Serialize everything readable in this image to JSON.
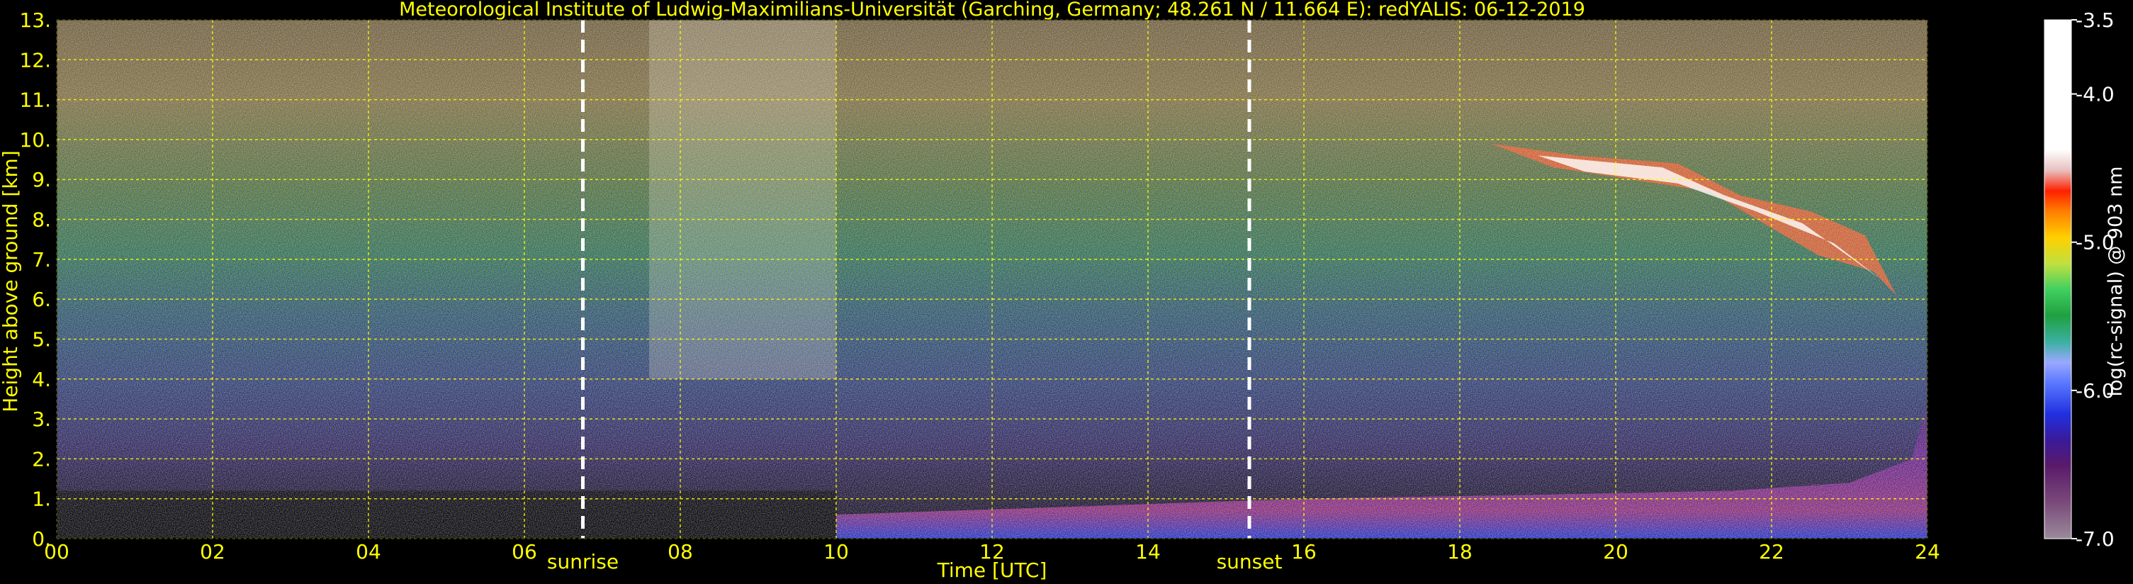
{
  "chart_data": {
    "type": "heatmap",
    "title": "Meteorological Institute of Ludwig-Maximilians-Universität (Garching, Germany; 48.261 N / 11.664 E):    redYALIS: 06-12-2019",
    "xlabel": "Time [UTC]",
    "ylabel": "Height above ground [km]",
    "xlim": [
      0,
      24
    ],
    "ylim": [
      0,
      13
    ],
    "x_ticks": [
      0,
      2,
      4,
      6,
      8,
      10,
      12,
      14,
      16,
      18,
      20,
      22,
      24
    ],
    "x_tick_labels": [
      "00",
      "02",
      "04",
      "06",
      "08",
      "10",
      "12",
      "14",
      "16",
      "18",
      "20",
      "22",
      "24"
    ],
    "y_ticks": [
      0,
      1,
      2,
      3,
      4,
      5,
      6,
      7,
      8,
      9,
      10,
      11,
      12,
      13
    ],
    "y_tick_labels": [
      "0.",
      "1.",
      "2.",
      "3.",
      "4.",
      "5.",
      "6.",
      "7.",
      "8.",
      "9.",
      "10.",
      "11.",
      "12.",
      "13."
    ],
    "grid": true,
    "events": [
      {
        "label": "sunrise",
        "time": 6.75
      },
      {
        "label": "sunset",
        "time": 15.3
      }
    ],
    "colorbar": {
      "label": "log(rc-signal) @ 903 nm",
      "range": [
        -7.0,
        -3.5
      ],
      "ticks": [
        -3.5,
        -4.0,
        -5.0,
        -6.0,
        -7.0
      ],
      "tick_labels": [
        "-3.5",
        "-4.0",
        "-5.0",
        "-6.0",
        "-7.0"
      ]
    },
    "features": [
      {
        "name": "cirrus-cloud",
        "time_start": 18.4,
        "time_end": 23.6,
        "height_top": 10.0,
        "height_bottom": 6.0
      },
      {
        "name": "boundary-layer",
        "time_start": 10.0,
        "time_end": 24.0,
        "height_top": 1.2,
        "height_bottom": 0.0
      }
    ]
  },
  "colors": {
    "text": "#ffff00",
    "grid": "#ffff00",
    "event_line": "#ffffff",
    "background": "#000000"
  }
}
